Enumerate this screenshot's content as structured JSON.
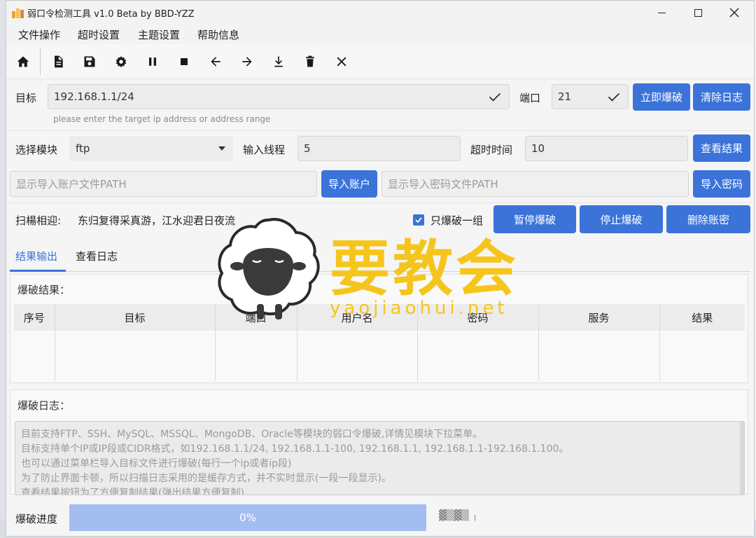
{
  "window": {
    "title": "弱口令检测工具 v1.0 Beta by BBD-YZZ"
  },
  "menu": {
    "items": [
      "文件操作",
      "超时设置",
      "主题设置",
      "帮助信息"
    ]
  },
  "toolbar": {
    "icons": [
      "home-icon",
      "file-icon",
      "save-icon",
      "gear-icon",
      "pause-icon",
      "stop-icon",
      "arrow-left-icon",
      "arrow-right-icon",
      "download-icon",
      "trash-icon",
      "close-icon"
    ]
  },
  "target": {
    "label": "目标",
    "value": "192.168.1.1/24",
    "hint": "please enter the target ip address or address range",
    "port_label": "端口",
    "port_value": "21",
    "start_button": "立即爆破",
    "clear_log_button": "清除日志"
  },
  "options": {
    "module_label": "选择模块",
    "module_value": "ftp",
    "threads_label": "输入线程",
    "threads_value": "5",
    "timeout_label": "超时时间",
    "timeout_value": "10",
    "view_results_button": "查看结果"
  },
  "import": {
    "user_path_placeholder": "显示导入账户文件PATH",
    "import_user_button": "导入账户",
    "pass_path_placeholder": "显示导入密码文件PATH",
    "import_pass_button": "导入密码"
  },
  "scan": {
    "label": "扫楊相迎:",
    "quote": "东归复得采真游，江水迎君日夜流",
    "only_one_label": "只爆破一组",
    "only_one_checked": true,
    "pause_button": "暂停爆破",
    "stop_button": "停止爆破",
    "delete_button": "删除账密"
  },
  "tabs": {
    "items": [
      "结果输出",
      "查看日志"
    ],
    "active": 0
  },
  "results": {
    "title": "爆破结果：",
    "columns": [
      "序号",
      "目标",
      "端口",
      "用户名",
      "密码",
      "服务",
      "结果"
    ]
  },
  "log": {
    "title": "爆破日志：",
    "lines": [
      "目前支持FTP、SSH、MySQL、MSSQL、MongoDB、Oracle等模块的弱口令爆破,详情见模块下拉菜单。",
      "目标支持单个IP或IP段或CIDR格式，如192.168.1.1/24, 192.168.1.1-100, 192.168.1.1, 192.168.1.1-192.168.1.100。",
      "也可以通过菜单栏导入目标文件进行爆破(每行一个ip或者ip段)",
      "为了防止界面卡顿，所以扫描日志采用的是缓存方式，并不实时显示(一段一段显示)。",
      "查看结果按钮为了方便复制结果(弹出结果方便复制)"
    ]
  },
  "progress": {
    "label": "爆破进度",
    "value_text": "0%",
    "percent": 0
  },
  "watermark": {
    "main": "要教会",
    "sub": "yaojiaohui.net"
  },
  "colors": {
    "accent": "#3b73d9",
    "progress_fill": "#a4bdf1",
    "watermark": "#f6c51c"
  }
}
